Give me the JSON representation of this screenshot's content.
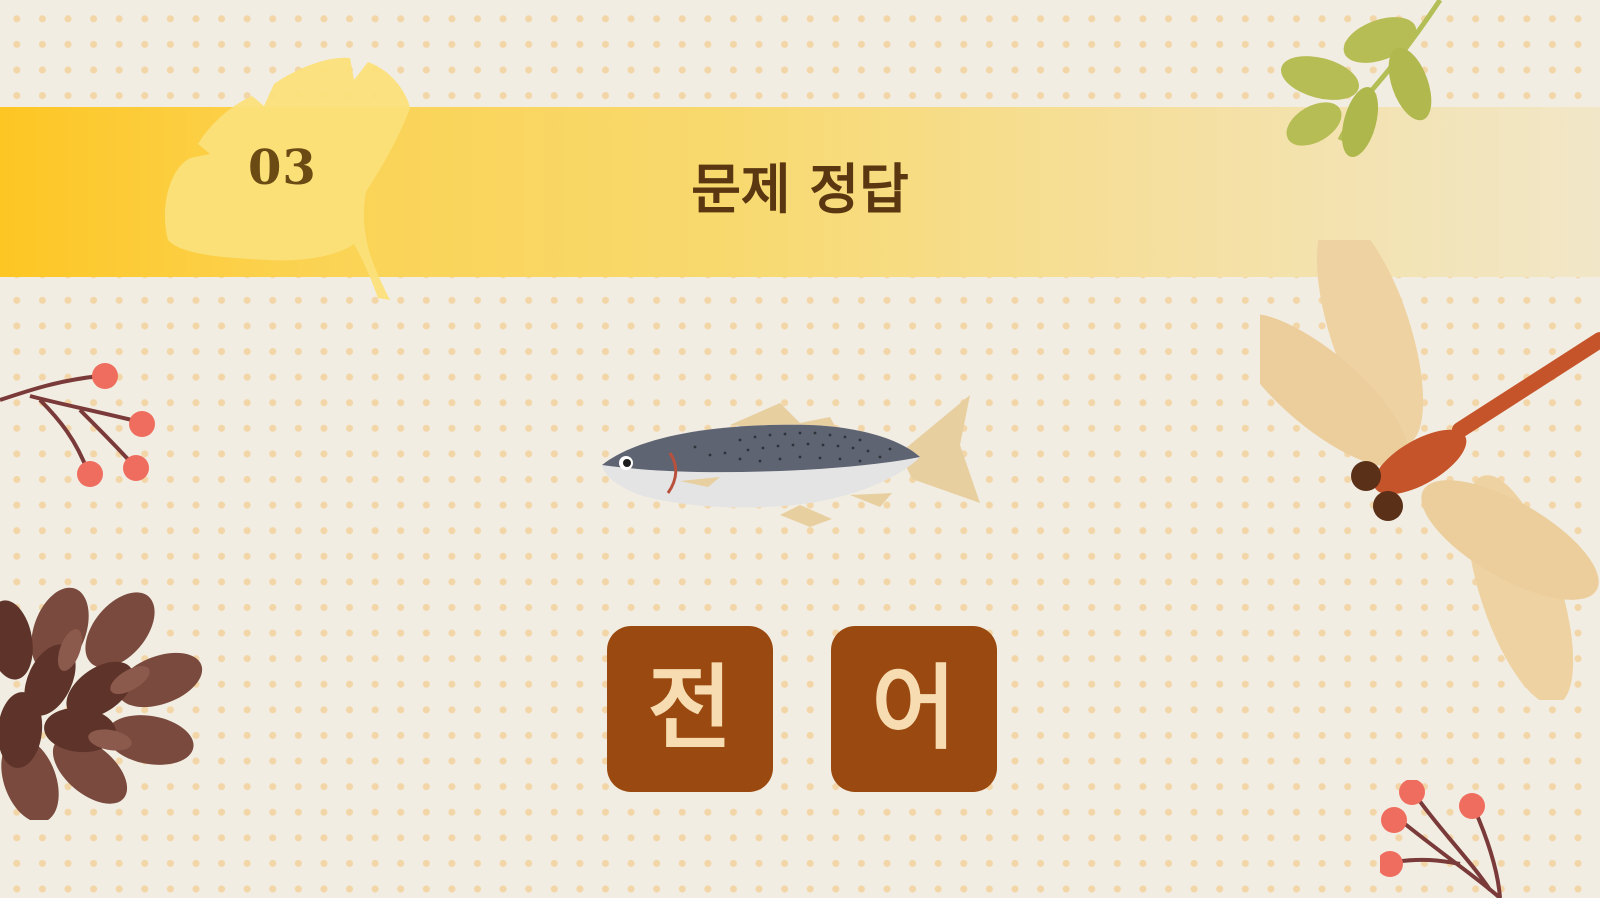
{
  "slide": {
    "number": "03",
    "title": "문제 정답"
  },
  "answer": {
    "letters": [
      "전",
      "어"
    ]
  },
  "illustrations": {
    "main": "fish-illustration",
    "decorations": [
      "ginkgo-leaf",
      "green-leaves-branch",
      "red-berry-branch",
      "pinecone",
      "dragonfly",
      "red-berry-branch"
    ]
  },
  "colors": {
    "background": "#f2ede2",
    "dots": "#f3d6a8",
    "banner_start": "#fdc623",
    "banner_end": "#f1e7c8",
    "title_text": "#5a3710",
    "tile_bg": "#9a4a10",
    "tile_text": "#f6dcb0"
  }
}
